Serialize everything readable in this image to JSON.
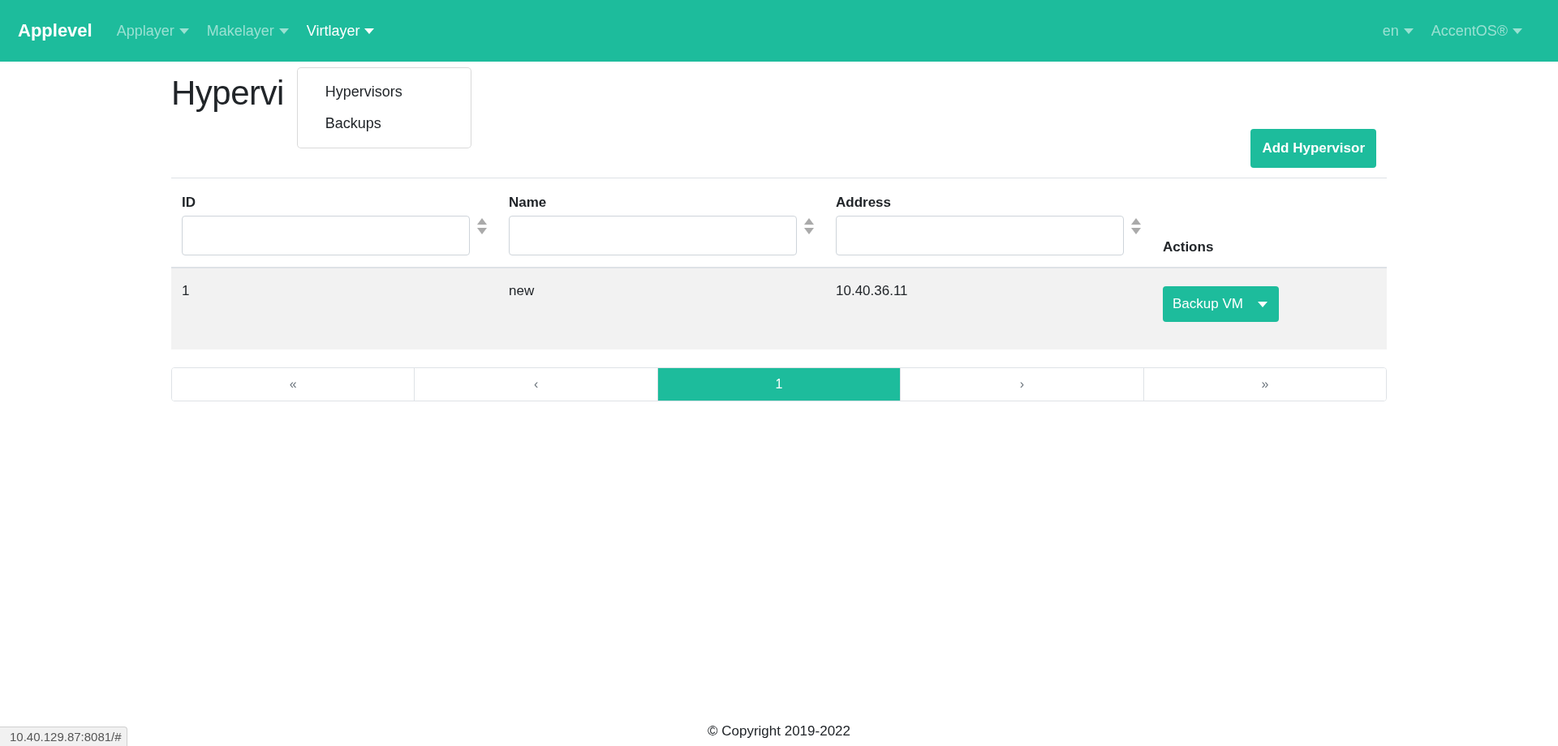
{
  "navbar": {
    "brand": "Applevel",
    "menus": [
      {
        "label": "Applayer",
        "selected": false
      },
      {
        "label": "Makelayer",
        "selected": false
      },
      {
        "label": "Virtlayer",
        "selected": true
      }
    ],
    "right_menus": [
      {
        "label": "en"
      },
      {
        "label": "AccentOS®"
      }
    ]
  },
  "dropdown": {
    "items": [
      "Hypervisors",
      "Backups"
    ]
  },
  "page_title": "Hypervi",
  "add_button": "Add Hypervisor",
  "table": {
    "columns": [
      {
        "label": "ID",
        "kind": "filter"
      },
      {
        "label": "Name",
        "kind": "filter"
      },
      {
        "label": "Address",
        "kind": "filter"
      },
      {
        "label": "Actions",
        "kind": "plain"
      }
    ],
    "rows": [
      {
        "cells": [
          "1",
          "new",
          "10.40.36.11"
        ],
        "action": "Backup VM"
      }
    ]
  },
  "pagination": [
    {
      "label": "«",
      "selected": false
    },
    {
      "label": "‹",
      "selected": false
    },
    {
      "label": "1",
      "selected": true
    },
    {
      "label": "›",
      "selected": false
    },
    {
      "label": "»",
      "selected": false
    }
  ],
  "footer": "© Copyright 2019-2022",
  "status_bar": "10.40.129.87:8081/#"
}
